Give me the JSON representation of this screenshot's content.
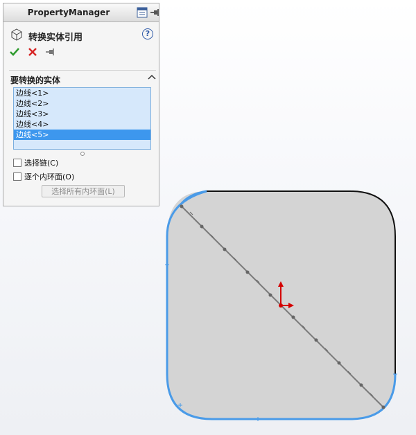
{
  "property_manager": {
    "title": "PropertyManager",
    "feature_title": "转换实体引用",
    "help_symbol": "?",
    "group_title": "要转换的实体",
    "entities": [
      "边线<1>",
      "边线<2>",
      "边线<3>",
      "边线<4>",
      "边线<5>"
    ],
    "selected_index": 4,
    "options": [
      {
        "label": "选择链(C)",
        "checked": false
      },
      {
        "label": "逐个内环面(O)",
        "checked": false
      }
    ],
    "select_all_loops_label": "选择所有内环面(L)",
    "colors": {
      "ok": "#2e9b2e",
      "cancel": "#d62626",
      "selection": "#3d97ee",
      "list_bg": "#d6e8fb"
    }
  },
  "viewport": {
    "colors": {
      "face": "#d4d4d4",
      "highlight_edge": "#4a9be8",
      "outline": "#111111",
      "diagonal": "#7a7a7a",
      "origin": "#d40000"
    },
    "icons": [
      "origin-triad-icon"
    ]
  }
}
